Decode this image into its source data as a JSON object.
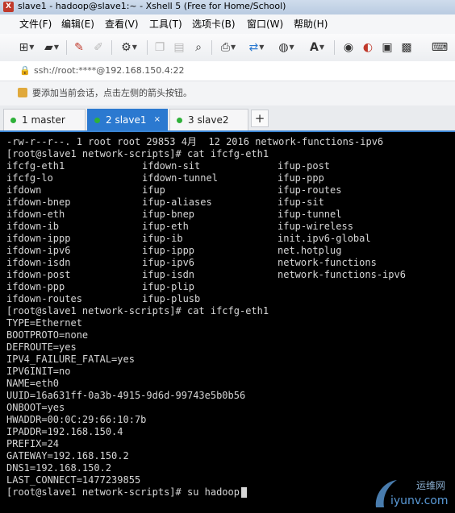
{
  "window": {
    "title": "slave1 - hadoop@slave1:~ - Xshell 5 (Free for Home/School)"
  },
  "menu": {
    "items": [
      "文件(F)",
      "编辑(E)",
      "查看(V)",
      "工具(T)",
      "选项卡(B)",
      "窗口(W)",
      "帮助(H)"
    ]
  },
  "address": {
    "value": "ssh://root:****@192.168.150.4:22"
  },
  "info": {
    "text": "要添加当前会话，点击左侧的箭头按钮。"
  },
  "tabs": [
    {
      "label": "1 master",
      "active": false,
      "status_color": "#2fb13a"
    },
    {
      "label": "2 slave1",
      "active": true,
      "status_color": "#2fb13a"
    },
    {
      "label": "3 slave2",
      "active": false,
      "status_color": "#2fb13a"
    }
  ],
  "tab_close": "×",
  "tab_add": "+",
  "terminal": {
    "line_first": "-rw-r--r--. 1 root root 29853 4月  12 2016 network-functions-ipv6",
    "prompt_cmd1": "[root@slave1 network-scripts]# cat ifcfg-eth1",
    "listing": [
      [
        "ifcfg-eth1",
        "ifdown-sit",
        "ifup-post"
      ],
      [
        "ifcfg-lo",
        "ifdown-tunnel",
        "ifup-ppp"
      ],
      [
        "ifdown",
        "ifup",
        "ifup-routes"
      ],
      [
        "ifdown-bnep",
        "ifup-aliases",
        "ifup-sit"
      ],
      [
        "ifdown-eth",
        "ifup-bnep",
        "ifup-tunnel"
      ],
      [
        "ifdown-ib",
        "ifup-eth",
        "ifup-wireless"
      ],
      [
        "ifdown-ippp",
        "ifup-ib",
        "init.ipv6-global"
      ],
      [
        "ifdown-ipv6",
        "ifup-ippp",
        "net.hotplug"
      ],
      [
        "ifdown-isdn",
        "ifup-ipv6",
        "network-functions"
      ],
      [
        "ifdown-post",
        "ifup-isdn",
        "network-functions-ipv6"
      ],
      [
        "ifdown-ppp",
        "ifup-plip",
        ""
      ],
      [
        "ifdown-routes",
        "ifup-plusb",
        ""
      ]
    ],
    "prompt_cmd2": "[root@slave1 network-scripts]# cat ifcfg-eth1",
    "config": [
      "TYPE=Ethernet",
      "BOOTPROTO=none",
      "DEFROUTE=yes",
      "IPV4_FAILURE_FATAL=yes",
      "IPV6INIT=no",
      "NAME=eth0",
      "UUID=16a631ff-0a3b-4915-9d6d-99743e5b0b56",
      "ONBOOT=yes",
      "HWADDR=00:0C:29:66:10:7b",
      "IPADDR=192.168.150.4",
      "PREFIX=24",
      "GATEWAY=192.168.150.2",
      "DNS1=192.168.150.2",
      "LAST_CONNECT=1477239855"
    ],
    "prompt_cmd3": "[root@slave1 network-scripts]# su hadoop"
  },
  "watermark": {
    "top": "运维网",
    "bottom": "iyunv.com"
  }
}
